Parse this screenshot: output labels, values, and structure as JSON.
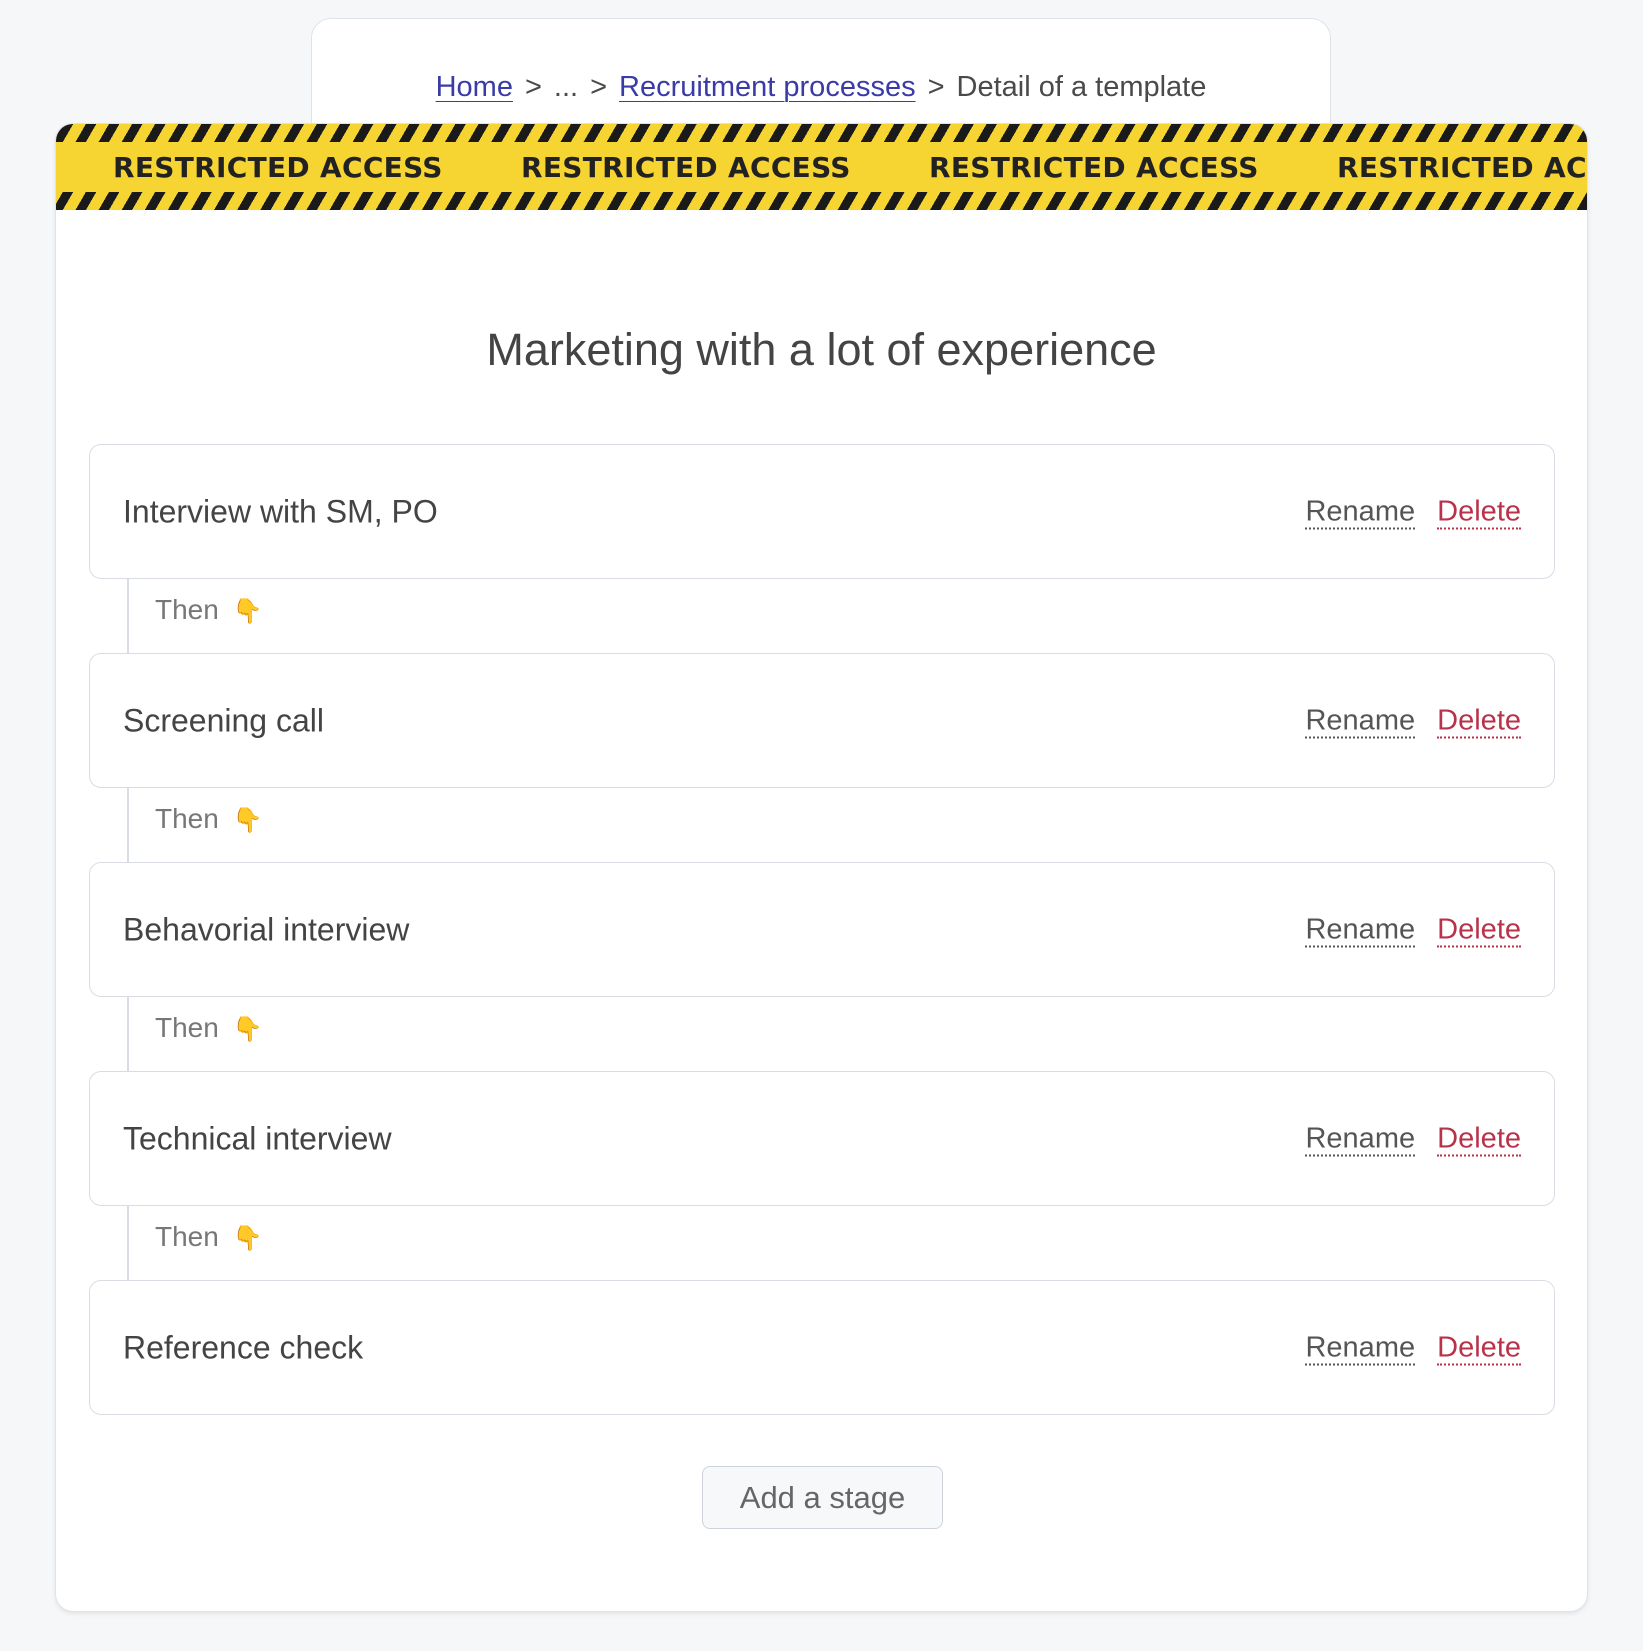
{
  "breadcrumb": {
    "home": "Home",
    "separator": ">",
    "ellipsis": "...",
    "recruitment_processes": "Recruitment processes",
    "current": "Detail of a template"
  },
  "banner": {
    "text": "RESTRICTED ACCESS",
    "colors": {
      "tape": "#f6d532",
      "stripes": "#1a1a1a"
    }
  },
  "template": {
    "title": "Marketing with a lot of experience"
  },
  "stages": [
    {
      "name": "Interview with SM, PO",
      "rename": "Rename",
      "delete": "Delete"
    },
    {
      "name": "Screening call",
      "rename": "Rename",
      "delete": "Delete"
    },
    {
      "name": "Behavorial interview",
      "rename": "Rename",
      "delete": "Delete"
    },
    {
      "name": "Technical interview",
      "rename": "Rename",
      "delete": "Delete"
    },
    {
      "name": "Reference check",
      "rename": "Rename",
      "delete": "Delete"
    }
  ],
  "connector": {
    "label": "Then",
    "icon": "backhand-index-pointing-down-icon",
    "emoji": "👇"
  },
  "add_stage_label": "Add a stage",
  "colors": {
    "link": "#3b3ba8",
    "delete": "#b8324a",
    "background": "#f6f7f9"
  }
}
